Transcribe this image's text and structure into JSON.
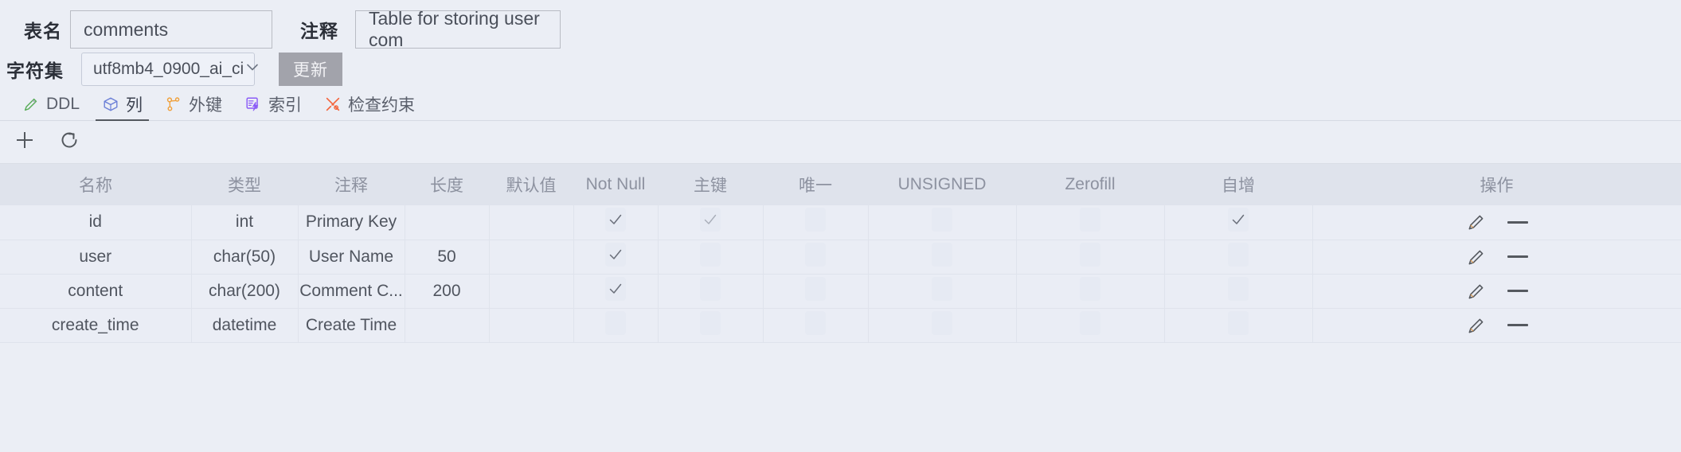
{
  "form": {
    "table_name_label": "表名",
    "table_name_value": "comments",
    "table_name_placeholder": "表名",
    "comment_label": "注释",
    "comment_value": "Table for storing user com",
    "comment_placeholder": "注释",
    "charset_label": "字符集",
    "charset_value": "utf8mb4_0900_ai_ci",
    "charset_options": [
      "utf8mb4_0900_ai_ci"
    ],
    "update_button": "更新"
  },
  "tabs": [
    {
      "label": "DDL",
      "icon": "pencil-icon",
      "active": false
    },
    {
      "label": "列",
      "icon": "cube-icon",
      "active": true
    },
    {
      "label": "外键",
      "icon": "foreign-key-icon",
      "active": false
    },
    {
      "label": "索引",
      "icon": "index-icon",
      "active": false
    },
    {
      "label": "检查约束",
      "icon": "tools-icon",
      "active": false
    }
  ],
  "toolbar": {
    "add_label": "add-column",
    "refresh_label": "refresh"
  },
  "table": {
    "headers": [
      "名称",
      "类型",
      "注释",
      "长度",
      "默认值",
      "Not Null",
      "主键",
      "唯一",
      "UNSIGNED",
      "Zerofill",
      "自增",
      "操作"
    ],
    "rows": [
      {
        "name": "id",
        "type": "int",
        "comment": "Primary Key",
        "length": "",
        "default": "",
        "not_null": true,
        "primary_key": true,
        "unique": false,
        "unsigned": false,
        "zerofill": false,
        "auto_increment": true
      },
      {
        "name": "user",
        "type": "char(50)",
        "comment": "User Name",
        "length": "50",
        "default": "",
        "not_null": true,
        "primary_key": false,
        "unique": false,
        "unsigned": false,
        "zerofill": false,
        "auto_increment": false
      },
      {
        "name": "content",
        "type": "char(200)",
        "comment": "Comment C...",
        "length": "200",
        "default": "",
        "not_null": true,
        "primary_key": false,
        "unique": false,
        "unsigned": false,
        "zerofill": false,
        "auto_increment": false
      },
      {
        "name": "create_time",
        "type": "datetime",
        "comment": "Create Time",
        "length": "",
        "default": "",
        "not_null": false,
        "primary_key": false,
        "unique": false,
        "unsigned": false,
        "zerofill": false,
        "auto_increment": false
      }
    ],
    "row_actions": {
      "edit": "edit-row",
      "delete": "delete-row"
    }
  },
  "colors": {
    "page_bg": "#ebeef5",
    "header_bg": "#dfe3ec",
    "row_bg": "#eaedf5",
    "border": "#dfe3ec",
    "button_bg": "#a2a3ab",
    "text": "#50555f",
    "muted_text": "#8d92a0",
    "icon_green": "#5aad5a",
    "icon_blue": "#6b7fd7",
    "icon_orange": "#f0a13c",
    "icon_purple": "#8b5cf6",
    "icon_red_orange": "#f4643c"
  }
}
